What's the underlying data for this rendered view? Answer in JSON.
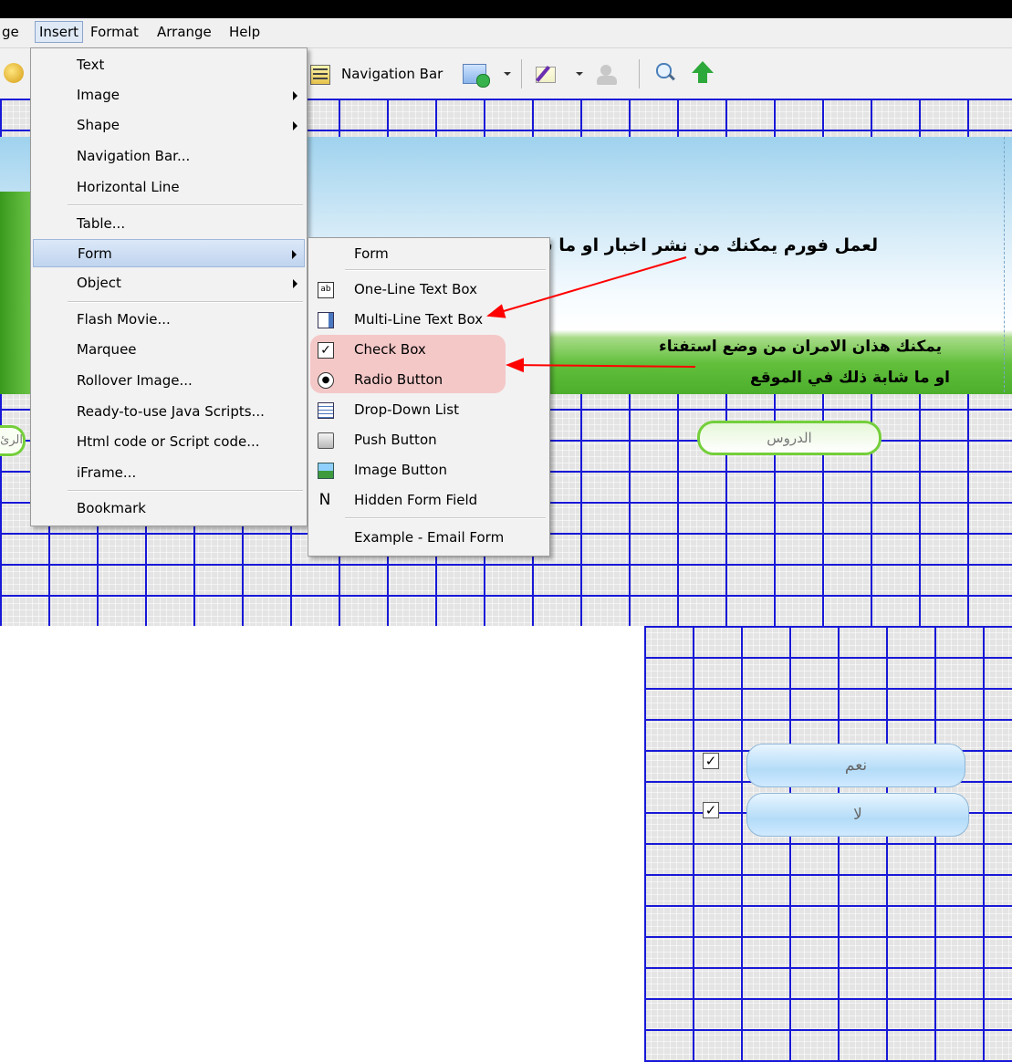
{
  "menubar": {
    "items": [
      "ge",
      "Insert",
      "Format",
      "Arrange",
      "Help"
    ]
  },
  "toolbar": {
    "navigation_bar_label": "Navigation Bar"
  },
  "insert_menu": {
    "items": [
      {
        "label": "Text"
      },
      {
        "label": "Image",
        "submenu": true
      },
      {
        "label": "Shape",
        "submenu": true
      },
      {
        "label": "Navigation Bar..."
      },
      {
        "label": "Horizontal Line"
      },
      {
        "label": "Table..."
      },
      {
        "label": "Form",
        "submenu": true,
        "selected": true
      },
      {
        "label": "Object",
        "submenu": true
      },
      {
        "label": "Flash Movie..."
      },
      {
        "label": "Marquee"
      },
      {
        "label": "Rollover Image..."
      },
      {
        "label": "Ready-to-use Java Scripts..."
      },
      {
        "label": "Html code or Script code..."
      },
      {
        "label": "iFrame..."
      },
      {
        "label": "Bookmark"
      }
    ]
  },
  "form_submenu": {
    "items": [
      {
        "label": "Form",
        "icon": "form-icon"
      },
      {
        "label": "One-Line Text Box",
        "icon": "one-line-textbox-icon"
      },
      {
        "label": "Multi-Line Text Box",
        "icon": "multi-line-textbox-icon"
      },
      {
        "label": "Check Box",
        "icon": "checkbox-icon"
      },
      {
        "label": "Radio Button",
        "icon": "radio-button-icon"
      },
      {
        "label": "Drop-Down List",
        "icon": "dropdown-list-icon"
      },
      {
        "label": "Push Button",
        "icon": "push-button-icon"
      },
      {
        "label": "Image Button",
        "icon": "image-button-icon"
      },
      {
        "label": "Hidden Form Field",
        "icon": "hidden-field-icon"
      },
      {
        "label": "Example - Email Form",
        "icon": ""
      }
    ]
  },
  "annotations": {
    "form_note": "لعمل فورم يمكنك من نشر اخبار او ما شابة ذلك",
    "poll_note_line1": "يمكنك هذان الامران من وضع استفتاء",
    "poll_note_line2": "او ما شابة ذلك في الموقع"
  },
  "page": {
    "lessons_button": "الدروس",
    "left_button_fragment": "الرئ",
    "yes_label": "نعم",
    "no_label": "لا"
  },
  "colors": {
    "grid_line": "#1818d8",
    "highlight": "#f5c8c8",
    "arrow": "#ff0000",
    "menu_selected": "#c5d9f1"
  }
}
